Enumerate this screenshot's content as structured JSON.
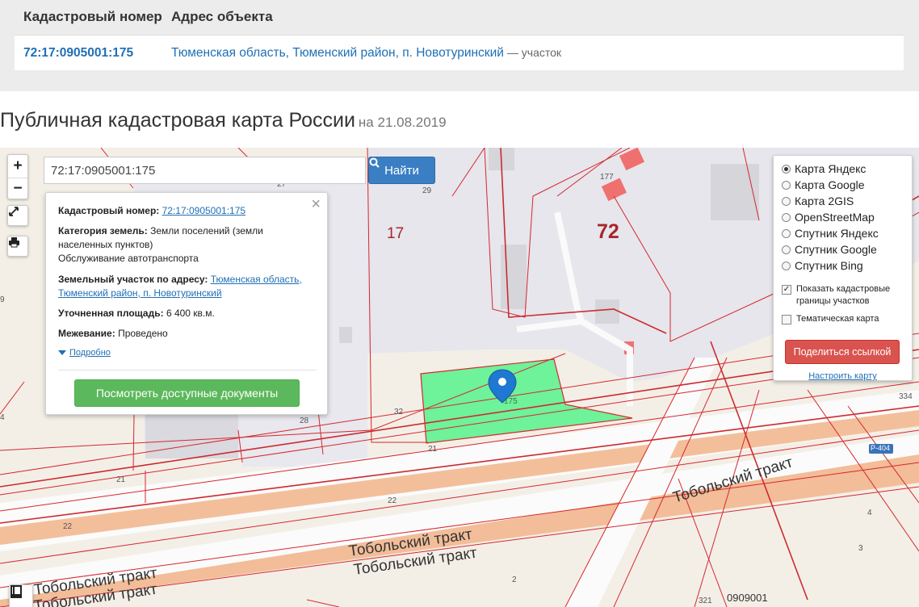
{
  "results_table": {
    "headers": [
      "Кадастровый номер",
      "Адрес объекта"
    ],
    "row": {
      "cadastral_number": "72:17:0905001:175",
      "address": "Тюменская область, Тюменский район, п. Новотуринский",
      "suffix": "— участок"
    }
  },
  "page": {
    "title": "Публичная кадастровая карта России",
    "date": "на 21.08.2019"
  },
  "map_controls": {
    "zoom_in": "+",
    "zoom_out": "−",
    "search_value": "72:17:0905001:175",
    "search_button": "Найти"
  },
  "popup": {
    "cad_label": "Кадастровый номер:",
    "cad_value": "72:17:0905001:175",
    "category_label": "Категория земель:",
    "category_value": "Земли поселений (земли населенных пунктов)",
    "usage_value": "Обслуживание автотранспорта",
    "address_label": "Земельный участок по адресу:",
    "address_value": "Тюменская область, Тюменский район, п. Новотуринский",
    "area_label": "Уточненная площадь:",
    "area_value": "6 400 кв.м.",
    "survey_label": "Межевание:",
    "survey_value": "Проведено",
    "more_link": "Подробно",
    "docs_button": "Посмотреть доступные документы",
    "close": "×"
  },
  "layers_panel": {
    "base_layers": [
      {
        "label": "Карта Яндекс",
        "selected": true
      },
      {
        "label": "Карта Google",
        "selected": false
      },
      {
        "label": "Карта 2GIS",
        "selected": false
      },
      {
        "label": "OpenStreetMap",
        "selected": false
      },
      {
        "label": "Спутник Яндекс",
        "selected": false
      },
      {
        "label": "Спутник Google",
        "selected": false
      },
      {
        "label": "Спутник Bing",
        "selected": false
      }
    ],
    "show_borders": {
      "label": "Показать кадастровые границы участков",
      "checked": true
    },
    "thematic": {
      "label": "Тематическая карта",
      "checked": false
    },
    "share_button": "Поделиться ссылкой",
    "setup_link": "Настроить карту"
  },
  "map_labels": {
    "quarter_17": "17",
    "quarter_72": "72",
    "parcel_175": "175",
    "n_177": "177",
    "n_29": "29",
    "n_27": "27",
    "n_32": "32",
    "n_28": "28",
    "n_21a": "21",
    "n_21b": "21",
    "n_22a": "22",
    "n_22b": "22",
    "n_334": "334",
    "n_4a": "4",
    "n_4b": "4",
    "n_3": "3",
    "n_2": "2",
    "n_321": "321",
    "n_0909001": "0909001",
    "n_9": "9",
    "road_badge": "Р-404",
    "road_1": "Тобольский тракт",
    "road_2": "Тобольский тракт",
    "road_3": "Тобольский тракт",
    "road_4": "Тобольский тракт",
    "road_5": "Тобольский тракт"
  },
  "colors": {
    "parcel_fill": "#6ef29a",
    "boundary": "#d7262e",
    "road": "#f1b48a",
    "link": "#1f6fb5"
  }
}
